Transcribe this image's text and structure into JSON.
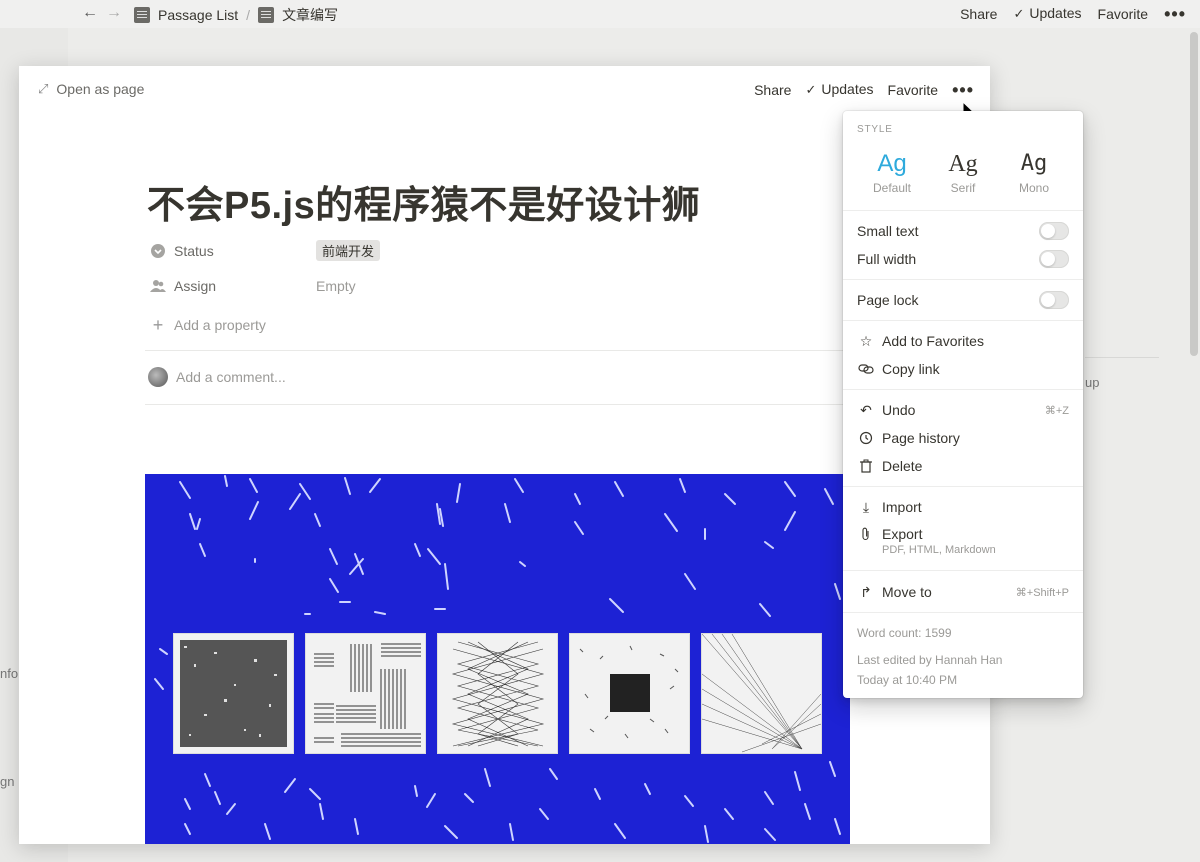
{
  "topbar": {
    "crumb1": "Passage List",
    "crumb_sep": "/",
    "crumb2": "文章编写",
    "share": "Share",
    "updates": "Updates",
    "favorite": "Favorite"
  },
  "background": {
    "frag_info": "nfo",
    "frag_gn": "gn",
    "frag_up": "up"
  },
  "modal": {
    "open_as_page": "Open as page",
    "share": "Share",
    "updates": "Updates",
    "favorite": "Favorite",
    "title": "不会P5.js的程序猿不是好设计狮",
    "properties": [
      {
        "name": "Status",
        "value": "前端开发"
      },
      {
        "name": "Assign",
        "value": "Empty"
      }
    ],
    "add_property": "Add a property",
    "comment_placeholder": "Add a comment..."
  },
  "menu": {
    "style_label": "STYLE",
    "styles": [
      {
        "glyph": "Ag",
        "label": "Default",
        "selected": true
      },
      {
        "glyph": "Ag",
        "label": "Serif",
        "selected": false
      },
      {
        "glyph": "Ag",
        "label": "Mono",
        "selected": false
      }
    ],
    "toggles": {
      "small_text": {
        "label": "Small text",
        "on": false
      },
      "full_width": {
        "label": "Full width",
        "on": false
      },
      "page_lock": {
        "label": "Page lock",
        "on": false
      }
    },
    "add_favorites": "Add to Favorites",
    "copy_link": "Copy link",
    "undo": "Undo",
    "undo_shortcut": "⌘+Z",
    "page_history": "Page history",
    "delete": "Delete",
    "import": "Import",
    "export": "Export",
    "export_sub": "PDF, HTML, Markdown",
    "move_to": "Move to",
    "move_shortcut": "⌘+Shift+P",
    "word_count": "Word count: 1599",
    "last_edited": "Last edited by Hannah Han",
    "edited_time": "Today at 10:40 PM"
  },
  "colors": {
    "accent": "#2eaadc",
    "cover_blue": "#1d22d4",
    "text": "#37352f",
    "muted": "#9b9a97"
  },
  "icons": [
    "back-arrow-icon",
    "forward-arrow-icon",
    "page-icon",
    "check-icon",
    "more-dots-icon",
    "expand-icon",
    "status-icon",
    "people-icon",
    "plus-icon",
    "star-icon",
    "link-icon",
    "undo-icon",
    "history-icon",
    "trash-icon",
    "import-icon",
    "paperclip-icon",
    "move-arrow-icon"
  ]
}
